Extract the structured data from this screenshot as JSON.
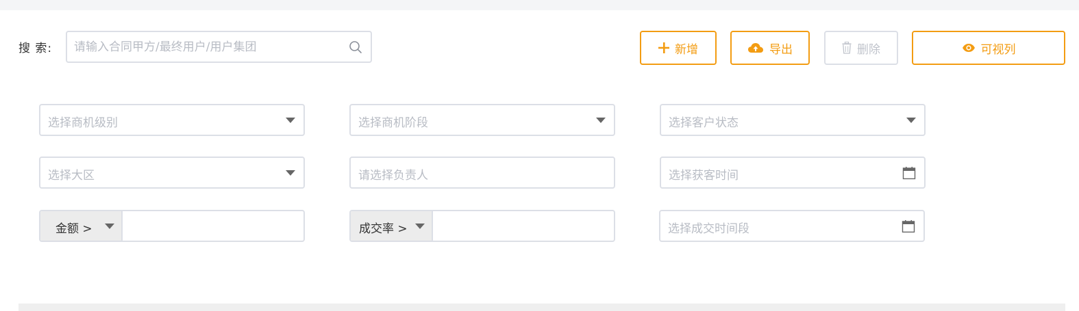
{
  "search": {
    "label": "搜 索:",
    "placeholder": "请输入合同甲方/最终用户/用户集团"
  },
  "toolbar": {
    "add_label": "新增",
    "export_label": "导出",
    "delete_label": "删除",
    "columns_label": "可视列"
  },
  "filters": {
    "opportunity_level": "选择商机级别",
    "opportunity_stage": "选择商机阶段",
    "customer_status": "选择客户状态",
    "region": "选择大区",
    "owner": "请选择负责人",
    "acquisition_time": "选择获客时间",
    "amount_operator": "金额 >",
    "win_rate_operator": "成交率 >",
    "deal_period": "选择成交时间段"
  },
  "colors": {
    "accent": "#f39c12",
    "border": "#dcdfe6",
    "placeholder": "#b8bcc4",
    "disabled": "#c0c4cc"
  }
}
